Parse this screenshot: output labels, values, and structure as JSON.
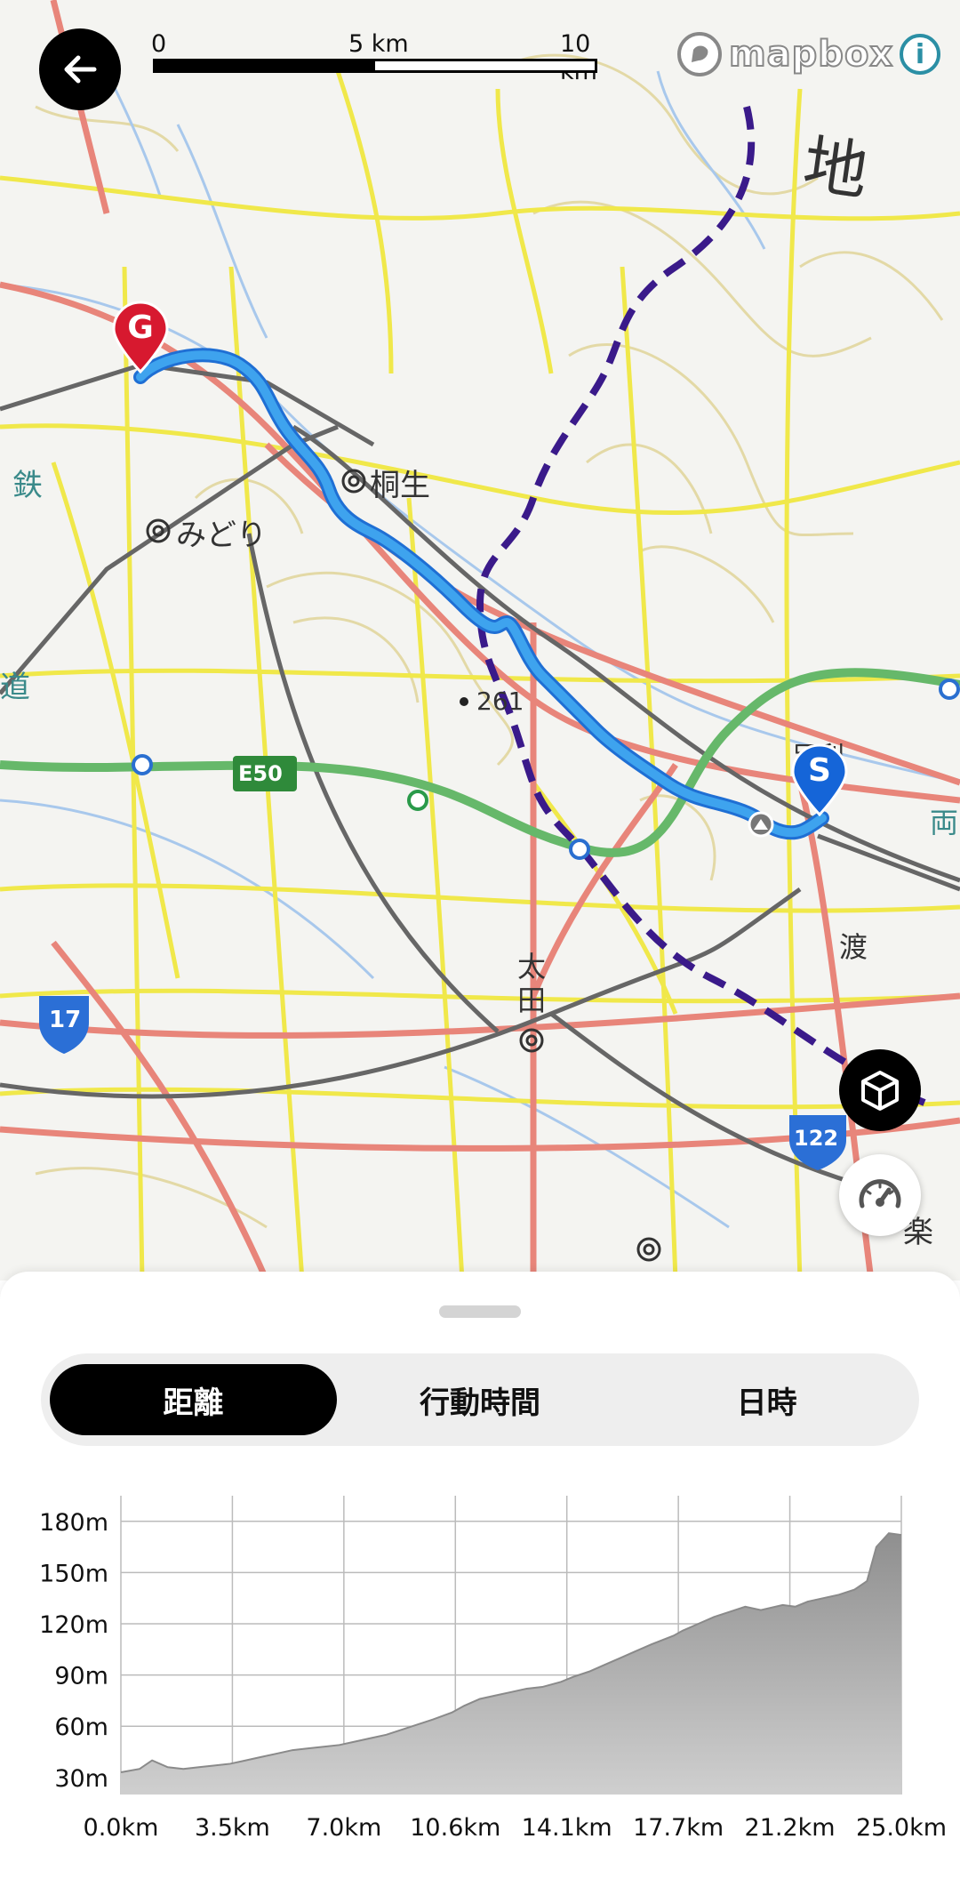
{
  "map": {
    "scale": {
      "labels": [
        "0",
        "5 km",
        "10 km"
      ]
    },
    "attribution": {
      "logo_text": "mapbox",
      "info_icon": "i"
    },
    "labels": {
      "kiryu": "桐生",
      "midori": "みどり",
      "ota_top": "太",
      "ota_bottom": "田",
      "chi": "地",
      "tetsu": "鉄",
      "michi": "道",
      "elevation_point": "261",
      "expressway": "E50",
      "route_17": "17",
      "route_122": "122",
      "ashikaga": "足利",
      "watari": "渡",
      "ryo": "両",
      "raku": "楽"
    },
    "markers": {
      "start": "S",
      "goal": "G"
    },
    "icons": {
      "back": "arrow-left-icon",
      "view3d": "cube-icon",
      "speed": "speedometer-icon"
    }
  },
  "tabs": [
    {
      "label": "距離",
      "active": true
    },
    {
      "label": "行動時間",
      "active": false
    },
    {
      "label": "日時",
      "active": false
    }
  ],
  "chart_data": {
    "type": "area",
    "xlabel": "",
    "ylabel": "",
    "x_ticks": [
      "0.0km",
      "3.5km",
      "7.0km",
      "10.6km",
      "14.1km",
      "17.7km",
      "21.2km",
      "25.0km"
    ],
    "y_ticks": [
      "30m",
      "60m",
      "90m",
      "120m",
      "150m",
      "180m"
    ],
    "xlim": [
      0,
      25.0
    ],
    "ylim": [
      20,
      195
    ],
    "grid": true,
    "color": "#a8a8a8",
    "x": [
      0,
      0.6,
      1.0,
      1.5,
      2.0,
      2.5,
      3.0,
      3.5,
      4.0,
      4.5,
      5.0,
      5.5,
      6.0,
      6.5,
      7.0,
      7.5,
      8.0,
      8.5,
      9.0,
      9.5,
      10.0,
      10.6,
      11.0,
      11.5,
      12.0,
      12.5,
      13.0,
      13.5,
      14.1,
      14.5,
      15.0,
      15.5,
      16.0,
      16.5,
      17.0,
      17.7,
      18.0,
      18.5,
      19.0,
      19.5,
      20.0,
      20.5,
      21.2,
      21.6,
      22.0,
      22.5,
      23.0,
      23.5,
      23.9,
      24.2,
      24.6,
      25.0
    ],
    "y": [
      33,
      35,
      40,
      36,
      35,
      36,
      37,
      38,
      40,
      42,
      44,
      46,
      47,
      48,
      49,
      51,
      53,
      55,
      58,
      61,
      64,
      68,
      72,
      76,
      78,
      80,
      82,
      83,
      86,
      89,
      92,
      96,
      100,
      104,
      108,
      113,
      116,
      120,
      124,
      127,
      130,
      128,
      131,
      130,
      133,
      135,
      137,
      140,
      145,
      165,
      173,
      172
    ]
  }
}
